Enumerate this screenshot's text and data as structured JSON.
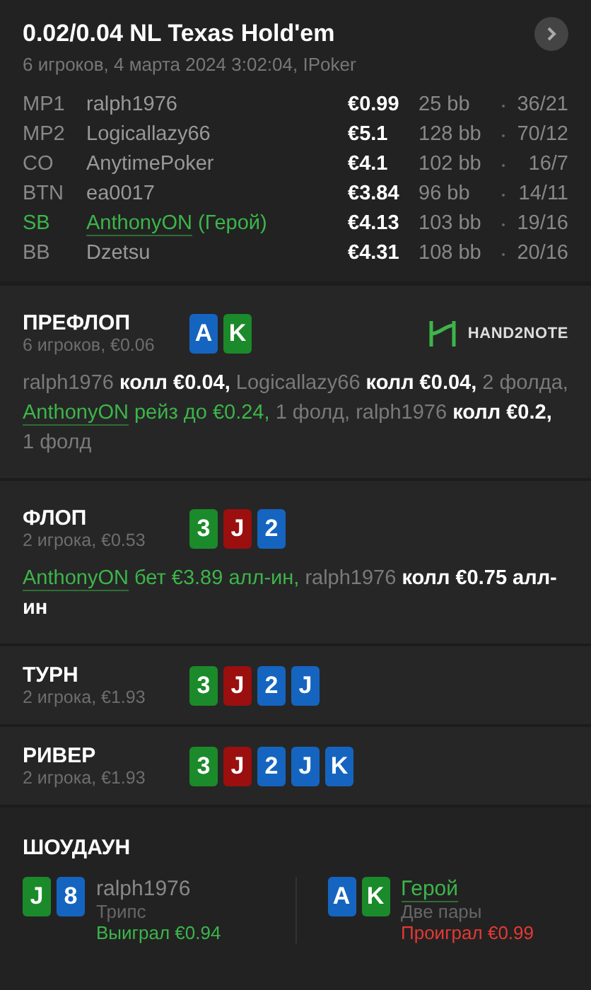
{
  "header": {
    "title": "0.02/0.04 NL Texas Hold'em",
    "subtitle": "6 игроков, 4 марта 2024 3:02:04, IPoker"
  },
  "players": [
    {
      "position": "MP1",
      "name": "ralph1976",
      "stack": "€0.99",
      "bb": "25 bb",
      "stats": "36/21",
      "hero": false
    },
    {
      "position": "MP2",
      "name": "Logicallazy66",
      "stack": "€5.1",
      "bb": "128 bb",
      "stats": "70/12",
      "hero": false
    },
    {
      "position": "CO",
      "name": "AnytimePoker",
      "stack": "€4.1",
      "bb": "102 bb",
      "stats": "16/7",
      "hero": false
    },
    {
      "position": "BTN",
      "name": "ea0017",
      "stack": "€3.84",
      "bb": "96 bb",
      "stats": "14/11",
      "hero": false
    },
    {
      "position": "SB",
      "name": "AnthonyON",
      "hero_tag": "(Герой)",
      "stack": "€4.13",
      "bb": "103 bb",
      "stats": "19/16",
      "hero": true
    },
    {
      "position": "BB",
      "name": "Dzetsu",
      "stack": "€4.31",
      "bb": "108 bb",
      "stats": "20/16",
      "hero": false
    }
  ],
  "streets": [
    {
      "title": "ПРЕФЛОП",
      "info": "6 игроков, €0.06",
      "logo": "HAND2NOTE",
      "cards": [
        {
          "rank": "A",
          "color": "#1565c0"
        },
        {
          "rank": "K",
          "color": "#1b8a2a"
        }
      ],
      "log": [
        {
          "kind": "player",
          "text": "ralph1976 "
        },
        {
          "kind": "action",
          "text": "колл €0.04, "
        },
        {
          "kind": "player",
          "text": "Logicallazy66 "
        },
        {
          "kind": "action",
          "text": "колл €0.04, "
        },
        {
          "kind": "plain",
          "text": "2 фолда, "
        },
        {
          "kind": "hero",
          "text": "AnthonyON"
        },
        {
          "kind": "hero_action",
          "text": " рейз до €0.24, "
        },
        {
          "kind": "plain",
          "text": "1 фолд, "
        },
        {
          "kind": "player",
          "text": "ralph1976 "
        },
        {
          "kind": "action",
          "text": "колл €0.2, "
        },
        {
          "kind": "plain",
          "text": "1 фолд"
        }
      ]
    },
    {
      "title": "ФЛОП",
      "info": "2 игрока, €0.53",
      "cards": [
        {
          "rank": "3",
          "color": "#1b8a2a"
        },
        {
          "rank": "J",
          "color": "#9b0f0f"
        },
        {
          "rank": "2",
          "color": "#1565c0"
        }
      ],
      "log": [
        {
          "kind": "hero",
          "text": "AnthonyON"
        },
        {
          "kind": "hero_action",
          "text": " бет €3.89 алл-ин, "
        },
        {
          "kind": "player",
          "text": "ralph1976 "
        },
        {
          "kind": "action",
          "text": "колл €0.75 алл-ин"
        }
      ]
    },
    {
      "title": "ТУРН",
      "info": "2 игрока, €1.93",
      "cards": [
        {
          "rank": "3",
          "color": "#1b8a2a"
        },
        {
          "rank": "J",
          "color": "#9b0f0f"
        },
        {
          "rank": "2",
          "color": "#1565c0"
        },
        {
          "rank": "J",
          "color": "#1565c0"
        }
      ]
    },
    {
      "title": "РИВЕР",
      "info": "2 игрока, €1.93",
      "cards": [
        {
          "rank": "3",
          "color": "#1b8a2a"
        },
        {
          "rank": "J",
          "color": "#9b0f0f"
        },
        {
          "rank": "2",
          "color": "#1565c0"
        },
        {
          "rank": "J",
          "color": "#1565c0"
        },
        {
          "rank": "K",
          "color": "#1565c0"
        }
      ]
    }
  ],
  "showdown": {
    "title": "ШОУДАУН",
    "hands": [
      {
        "name": "ralph1976",
        "hero": false,
        "combo": "Трипс",
        "result": "Выиграл €0.94",
        "won": true,
        "cards": [
          {
            "rank": "J",
            "color": "#1b8a2a"
          },
          {
            "rank": "8",
            "color": "#1565c0"
          }
        ]
      },
      {
        "name": "Герой",
        "hero": true,
        "combo": "Две пары",
        "result": "Проиграл €0.99",
        "won": false,
        "cards": [
          {
            "rank": "A",
            "color": "#1565c0"
          },
          {
            "rank": "K",
            "color": "#1b8a2a"
          }
        ]
      }
    ]
  }
}
